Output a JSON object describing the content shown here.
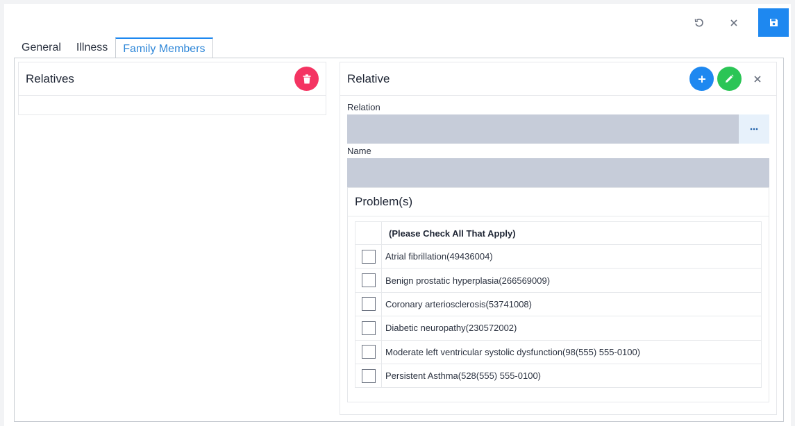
{
  "toolbar": {
    "undo_icon": "undo-icon",
    "close_icon": "close-icon",
    "save_icon": "save-icon",
    "save_color": "#1e88f0"
  },
  "tabs": [
    {
      "label": "General"
    },
    {
      "label": "Illness"
    },
    {
      "label": "Family Members",
      "active": true
    }
  ],
  "relatives": {
    "title": "Relatives",
    "delete_color": "#f43462"
  },
  "relative": {
    "title": "Relative",
    "add_color": "#1e88f0",
    "edit_color": "#2bc556",
    "relation_label": "Relation",
    "relation_value": "",
    "name_label": "Name",
    "name_value": ""
  },
  "problems": {
    "title": "Problem(s)",
    "header": "(Please Check All That Apply)",
    "items": [
      {
        "label": "Atrial fibrillation(49436004)",
        "checked": false
      },
      {
        "label": "Benign prostatic hyperplasia(266569009)",
        "checked": false
      },
      {
        "label": "Coronary arteriosclerosis(53741008)",
        "checked": false
      },
      {
        "label": "Diabetic neuropathy(230572002)",
        "checked": false
      },
      {
        "label": "Moderate left ventricular systolic dysfunction(98(555) 555-0100)",
        "checked": false
      },
      {
        "label": "Persistent Asthma(528(555) 555-0100)",
        "checked": false
      }
    ]
  }
}
